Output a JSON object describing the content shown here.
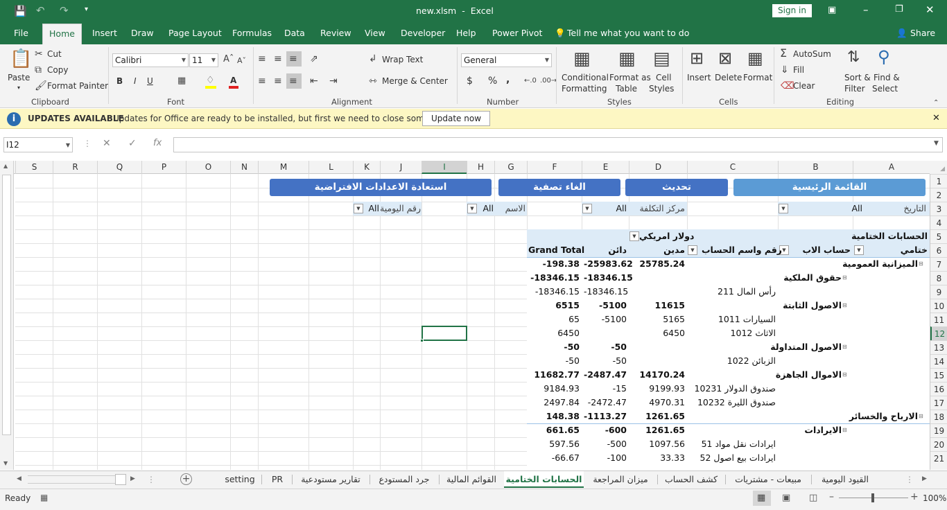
{
  "window": {
    "file_name": "new.xlsm",
    "separator": "-",
    "app_name": "Excel",
    "sign_in": "Sign in"
  },
  "ribbon_tabs": [
    "File",
    "Home",
    "Insert",
    "Draw",
    "Page Layout",
    "Formulas",
    "Data",
    "Review",
    "View",
    "Developer",
    "Help",
    "Power Pivot"
  ],
  "tell_me": "Tell me what you want to do",
  "share": "Share",
  "clipboard": {
    "paste": "Paste",
    "cut": "Cut",
    "copy": "Copy",
    "format_painter": "Format Painter",
    "group": "Clipboard"
  },
  "font": {
    "name": "Calibri",
    "size": "11",
    "bold": "B",
    "italic": "I",
    "underline": "U",
    "color_letter": "A",
    "group": "Font"
  },
  "alignment": {
    "wrap": "Wrap Text",
    "merge": "Merge & Center",
    "group": "Alignment"
  },
  "number": {
    "format": "General",
    "currency": "$",
    "percent": "%",
    "comma": ",",
    "group": "Number"
  },
  "styles": {
    "conditional": "Conditional",
    "formatting": "Formatting",
    "format_as": "Format as",
    "table": "Table",
    "cell": "Cell",
    "cell_styles": "Styles",
    "group": "Styles"
  },
  "cells": {
    "insert": "Insert",
    "delete": "Delete",
    "format": "Format",
    "group": "Cells"
  },
  "editing": {
    "autosum": "AutoSum",
    "fill": "Fill",
    "clear": "Clear",
    "sort": "Sort &",
    "filter": "Filter",
    "find": "Find &",
    "select": "Select",
    "group": "Editing"
  },
  "message": {
    "title": "UPDATES AVAILABLE",
    "text": "Updates for Office are ready to be installed, but first we need to close some apps.",
    "button": "Update now"
  },
  "formula_bar": {
    "name_box": "I12",
    "fx": "fx",
    "value": ""
  },
  "columns": [
    "S",
    "R",
    "Q",
    "P",
    "O",
    "N",
    "M",
    "L",
    "K",
    "J",
    "I",
    "H",
    "G",
    "F",
    "E",
    "D",
    "C",
    "B",
    "A"
  ],
  "rows": [
    "1",
    "2",
    "3",
    "4",
    "5",
    "6",
    "7",
    "8",
    "9",
    "10",
    "11",
    "12",
    "13",
    "14",
    "15",
    "16",
    "17",
    "18",
    "19",
    "20",
    "21"
  ],
  "buttons": {
    "main_menu": "القائمة الرئيسية",
    "refresh": "تحديث",
    "clear_filter": "الغاء تصفية",
    "restore": "استعادة الاعدادات الافتراضية"
  },
  "filters": {
    "date_label": "التاريخ",
    "date_value": "All",
    "cost_center_label": "مركز التكلفة",
    "cost_center_value": "All",
    "name_label": "الاسم",
    "name_value": "All",
    "journal_label": "رقم اليومية",
    "journal_value": "All"
  },
  "pivot": {
    "title": "الحسابات الختامية",
    "currency": "دولار امريكي",
    "h_final": "ختامي",
    "h_parent": "حساب الاب",
    "h_account": "رقم واسم الحساب",
    "h_debit": "مدين",
    "h_credit": "دائن",
    "h_total": "Grand Total",
    "rows": [
      {
        "label": "الميزانية العمومية",
        "level": 0,
        "debit": "25785.24",
        "credit": "-25983.62",
        "total": "-198.38",
        "bold": true
      },
      {
        "label": "حقوق الملكية",
        "level": 1,
        "debit": "",
        "credit": "-18346.15",
        "total": "-18346.15",
        "bold": true
      },
      {
        "label": "رأس المال 211",
        "level": 2,
        "debit": "",
        "credit": "-18346.15",
        "total": "-18346.15",
        "bold": false
      },
      {
        "label": "الاصول الثابتة",
        "level": 1,
        "debit": "11615",
        "credit": "-5100",
        "total": "6515",
        "bold": true
      },
      {
        "label": "السيارات 1011",
        "level": 2,
        "debit": "5165",
        "credit": "-5100",
        "total": "65",
        "bold": false
      },
      {
        "label": "الاثاث 1012",
        "level": 2,
        "debit": "6450",
        "credit": "",
        "total": "6450",
        "bold": false
      },
      {
        "label": "الاصول المتداولة",
        "level": 1,
        "debit": "",
        "credit": "-50",
        "total": "-50",
        "bold": true
      },
      {
        "label": "الزبائن 1022",
        "level": 2,
        "debit": "",
        "credit": "-50",
        "total": "-50",
        "bold": false
      },
      {
        "label": "الاموال الجاهزة",
        "level": 1,
        "debit": "14170.24",
        "credit": "-2487.47",
        "total": "11682.77",
        "bold": true
      },
      {
        "label": "صندوق الدولار 10231",
        "level": 2,
        "debit": "9199.93",
        "credit": "-15",
        "total": "9184.93",
        "bold": false
      },
      {
        "label": "صندوق الليرة 10232",
        "level": 2,
        "debit": "4970.31",
        "credit": "-2472.47",
        "total": "2497.84",
        "bold": false
      },
      {
        "label": "الارباح والخسائر",
        "level": 0,
        "debit": "1261.65",
        "credit": "-1113.27",
        "total": "148.38",
        "bold": true
      },
      {
        "label": "الايرادات",
        "level": 1,
        "debit": "1261.65",
        "credit": "-600",
        "total": "661.65",
        "bold": true
      },
      {
        "label": "ايرادات نقل مواد 51",
        "level": 2,
        "debit": "1097.56",
        "credit": "-500",
        "total": "597.56",
        "bold": false
      },
      {
        "label": "ايرادات بيع اصول 52",
        "level": 2,
        "debit": "33.33",
        "credit": "-100",
        "total": "-66.67",
        "bold": false
      }
    ]
  },
  "sheets": [
    "setting",
    "PR",
    "تقارير مستودعية",
    "جرد المستودع",
    "القوائم المالية",
    "الحسابات الختامية",
    "ميزان المراجعة",
    "كشف الحساب",
    "مبيعات - مشتريات",
    "القيود اليومية"
  ],
  "active_sheet": "الحسابات الختامية",
  "status": {
    "ready": "Ready",
    "zoom": "100%"
  },
  "colors": {
    "excel_green": "#217346",
    "button_blue": "#4472c4",
    "pivot_header": "#ddebf7"
  }
}
